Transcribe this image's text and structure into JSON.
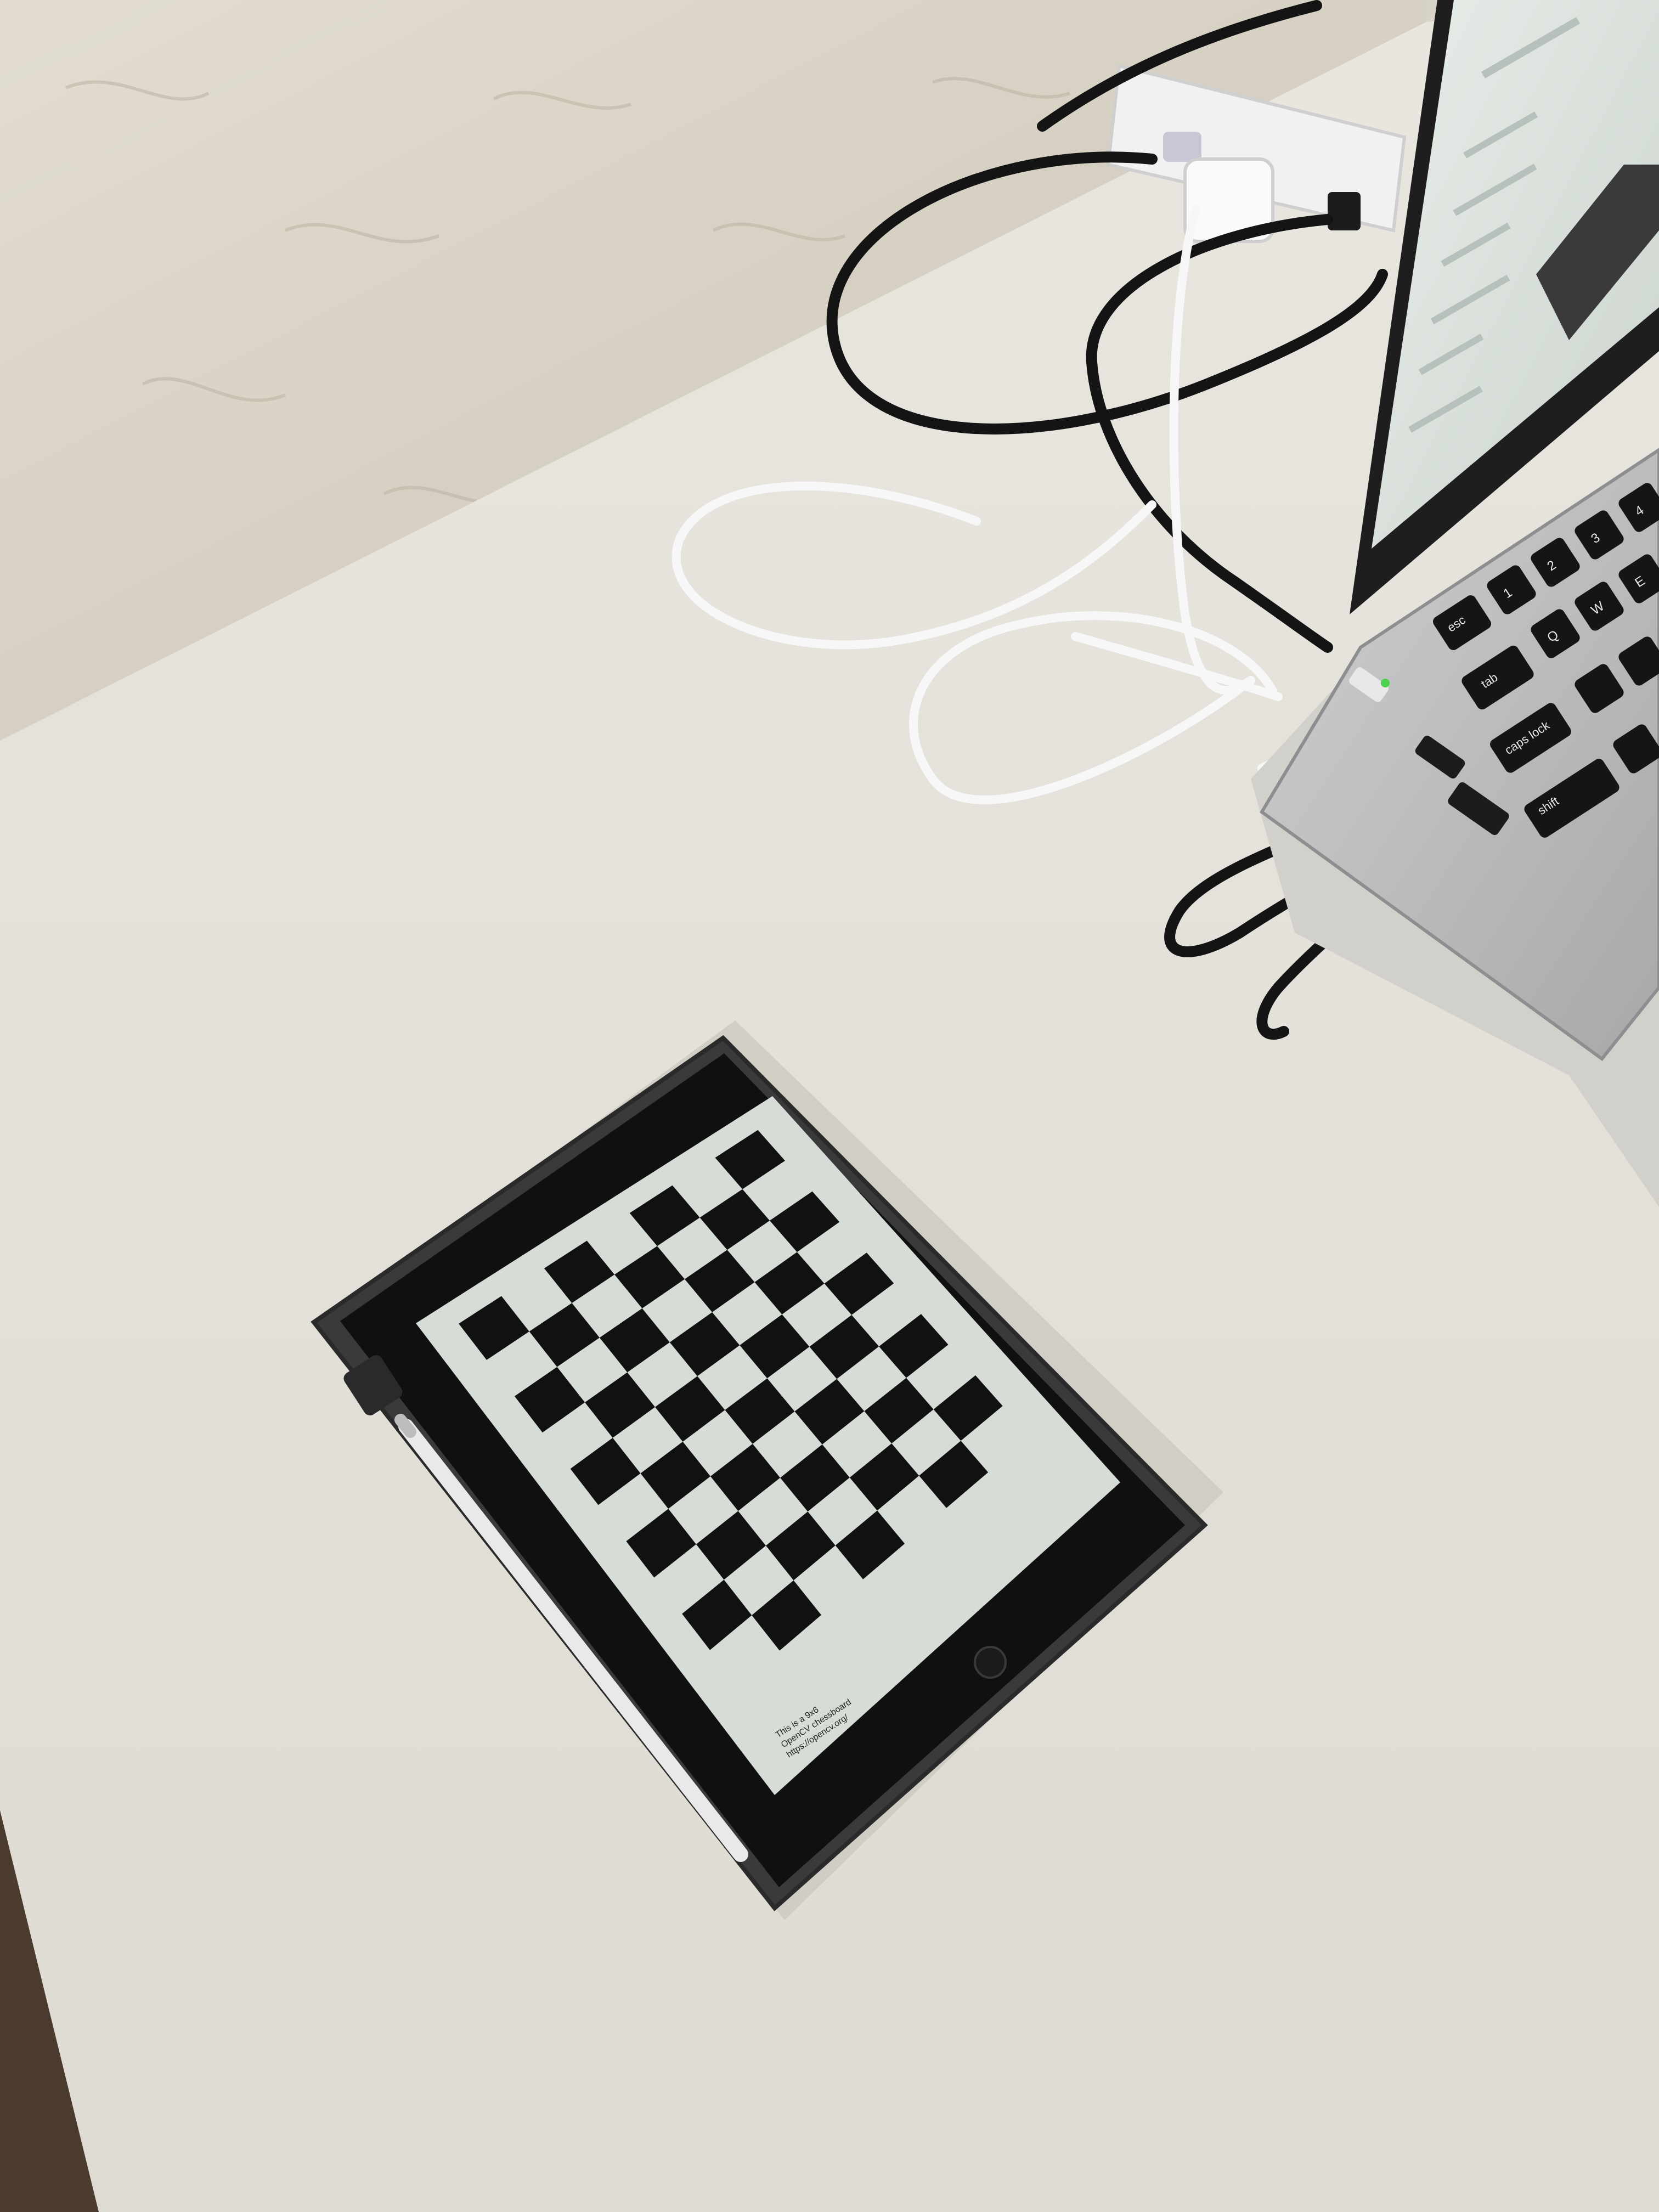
{
  "scene": {
    "description_objects": [
      "wall",
      "desk",
      "power-strip",
      "cables",
      "laptop",
      "tablet",
      "stylus"
    ],
    "colors": {
      "wall": "#d9d4c6",
      "desk": "#e6e4dc",
      "tablet_case": "#3a3a3c",
      "tablet_bezel": "#101010",
      "tablet_screen": "#d6ddd6",
      "checker_dark": "#111111",
      "laptop_body": "#b9bbbd",
      "laptop_screen": "#dfe7e2",
      "power_strip": "#f1f1f1"
    }
  },
  "tablet": {
    "checkerboard": {
      "rows": 9,
      "cols": 6
    },
    "caption_lines": [
      "This is a 9x6",
      "OpenCV chessboard",
      "https://opencv.org/"
    ]
  },
  "laptop": {
    "keys": [
      "esc",
      "tab",
      "caps lock",
      "shift"
    ],
    "number_keys": [
      "1",
      "2",
      "3",
      "4"
    ],
    "letter_keys": [
      "Q",
      "W",
      "E"
    ]
  }
}
